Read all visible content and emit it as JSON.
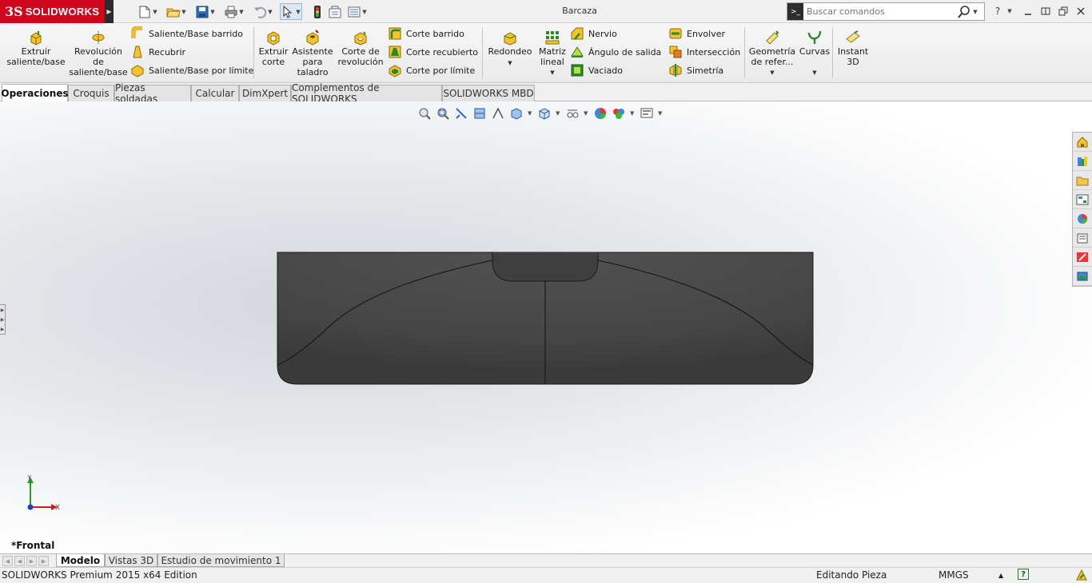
{
  "app": {
    "logo_mark": "3S",
    "logo_text": "SOLIDWORKS",
    "document_title": "Barcaza"
  },
  "quick_access": [
    "new-document-icon",
    "open-icon",
    "save-icon",
    "print-icon",
    "undo-icon",
    "select-icon",
    "rebuild-icon",
    "file-properties-icon",
    "options-icon"
  ],
  "search": {
    "placeholder": "Buscar comandos"
  },
  "command_manager": {
    "extrude_boss": "Extruir\nsaliente/base",
    "revolve_boss": "Revolución\nde\nsaliente/base",
    "swept_boss": "Saliente/Base barrido",
    "lofted_boss": "Recubrir",
    "boundary_boss": "Saliente/Base por límite",
    "extrude_cut": "Extruir\ncorte",
    "hole_wizard": "Asistente\npara\ntaladro",
    "revolve_cut": "Corte de\nrevolución",
    "swept_cut": "Corte barrido",
    "lofted_cut": "Corte recubierto",
    "boundary_cut": "Corte por límite",
    "fillet": "Redondeo",
    "linear_pattern": "Matriz\nlineal",
    "rib": "Nervio",
    "draft": "Ángulo de salida",
    "shell": "Vaciado",
    "wrap": "Envolver",
    "intersect": "Intersección",
    "mirror": "Simetría",
    "reference_geometry": "Geometría\nde refer...",
    "curves": "Curvas",
    "instant3d": "Instant\n3D"
  },
  "tabs": [
    "Operaciones",
    "Croquis",
    "Piezas soldadas",
    "Calcular",
    "DimXpert",
    "Complementos de SOLIDWORKS",
    "SOLIDWORKS MBD"
  ],
  "active_tab": "Operaciones",
  "viewport": {
    "view_name": "*Frontal",
    "triad_y": "Y",
    "triad_x": "X"
  },
  "model_tabs": [
    "Modelo",
    "Vistas 3D",
    "Estudio de movimiento 1"
  ],
  "active_model_tab": "Modelo",
  "status_bar": {
    "edition": "SOLIDWORKS Premium 2015 x64 Edition",
    "mode": "Editando Pieza",
    "units": "MMGS",
    "units_caret": "▲",
    "help": "?"
  },
  "colors": {
    "brand_red": "#d0041a",
    "model_fill": "#4a4a4a",
    "model_edge": "#1a1a1a"
  }
}
